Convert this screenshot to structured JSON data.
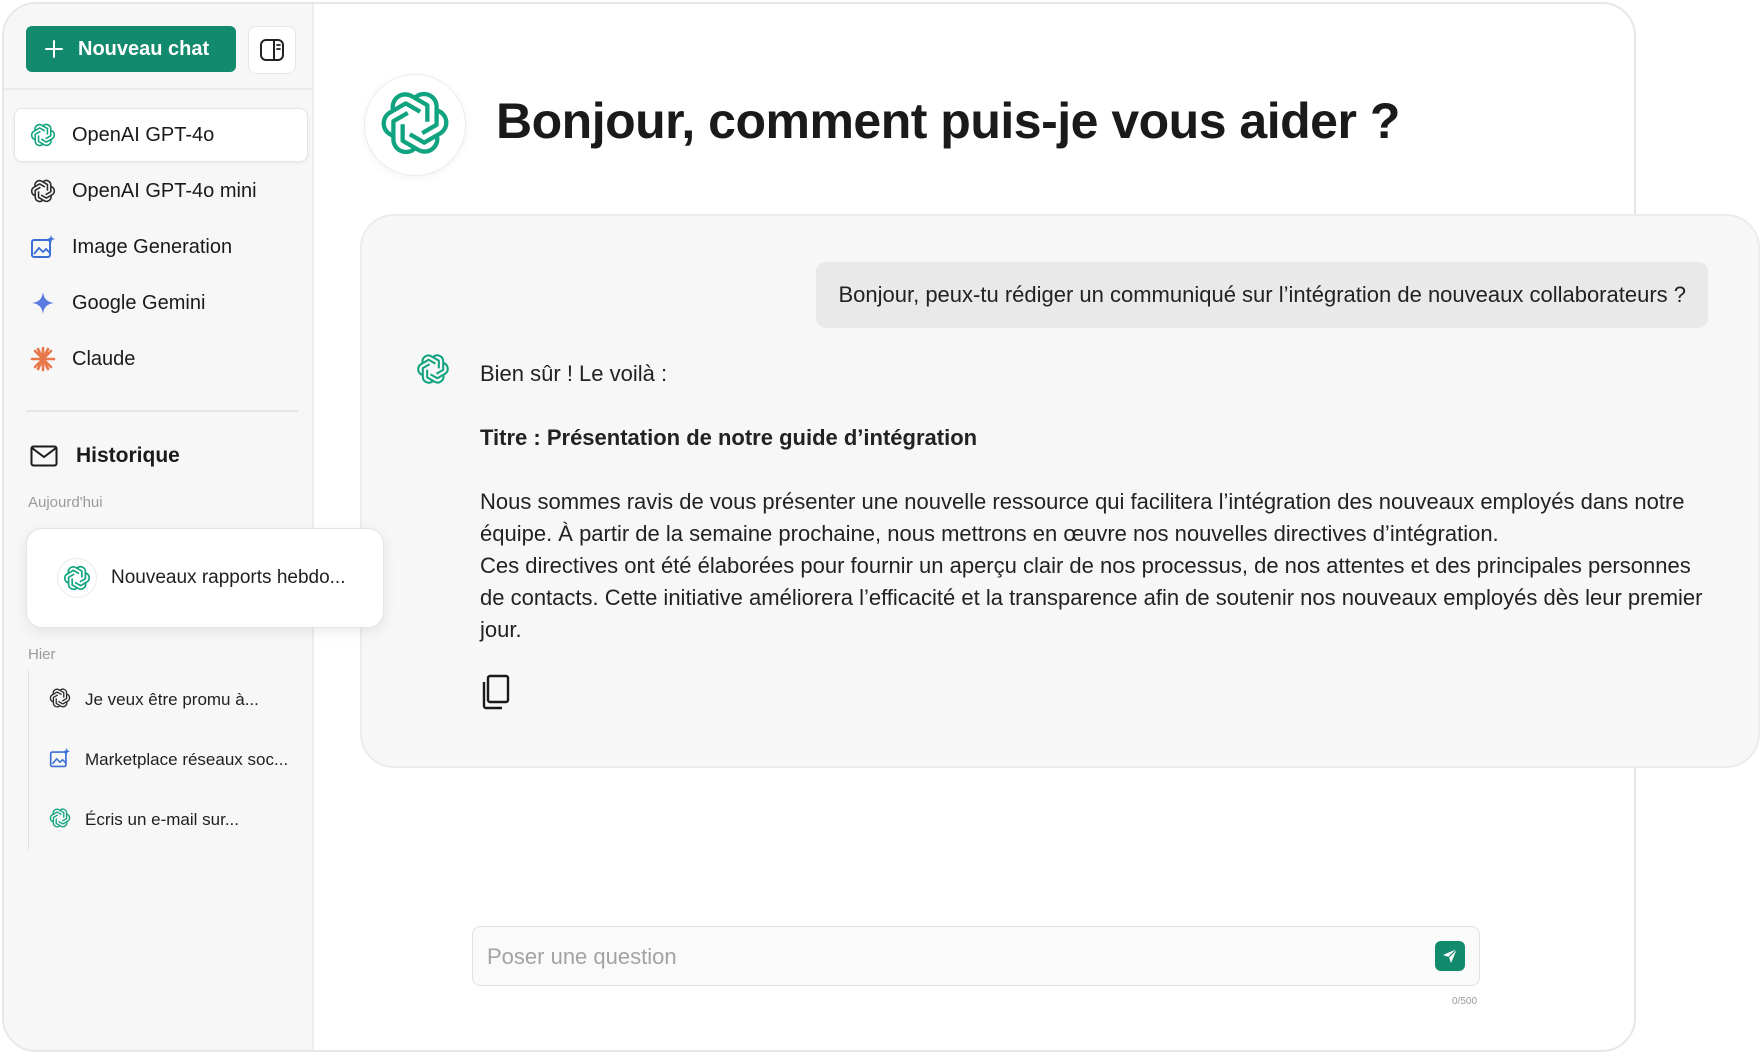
{
  "sidebar": {
    "new_chat_label": "Nouveau chat",
    "models": [
      {
        "label": "OpenAI GPT-4o",
        "icon": "openai-icon",
        "active": true
      },
      {
        "label": "OpenAI GPT-4o mini",
        "icon": "openai-icon",
        "active": false
      },
      {
        "label": "Image Generation",
        "icon": "image-generation-icon",
        "active": false
      },
      {
        "label": "Google Gemini",
        "icon": "gemini-icon",
        "active": false
      },
      {
        "label": "Claude",
        "icon": "claude-icon",
        "active": false
      }
    ],
    "history_title": "Historique",
    "history_icon": "envelope-icon",
    "today_label": "Aujourd'hui",
    "today_items": [
      {
        "label": "Nouveaux rapports hebdo...",
        "icon": "openai-icon"
      }
    ],
    "yesterday_label": "Hier",
    "yesterday_items": [
      {
        "label": "Je veux être promu à...",
        "icon": "openai-icon"
      },
      {
        "label": "Marketplace réseaux soc...",
        "icon": "image-generation-icon"
      },
      {
        "label": "Écris un e-mail sur...",
        "icon": "openai-icon"
      }
    ]
  },
  "main": {
    "welcome_title": "Bonjour, comment puis-je vous aider ?",
    "user_message": "Bonjour, peux-tu rédiger un communiqué sur l’intégration de nouveaux collaborateurs ?",
    "assistant": {
      "intro": "Bien sûr ! Le voilà :",
      "heading": "Titre : Présentation de notre guide d’intégration",
      "paragraph_1": "Nous sommes ravis de vous présenter une nouvelle ressource qui facilitera l’intégration des nouveaux employés dans notre équipe. À partir de la semaine prochaine, nous mettrons en œuvre nos nouvelles directives d’intégration.",
      "paragraph_2": "Ces directives ont été élaborées pour fournir un aperçu clair de nos processus, de nos attentes et des principales personnes de contacts. Cette initiative améliorera l’efficacité et la transparence afin de soutenir nos nouveaux employés dès leur premier jour."
    },
    "input": {
      "placeholder": "Poser une question",
      "value": "",
      "counter": "0/500"
    }
  },
  "colors": {
    "accent": "#128a6d",
    "openai": "#10a37f",
    "image_generation": "#3b6fd6",
    "gemini": "#5b7be0",
    "claude": "#e8774a",
    "sidebar_bg": "#f7f7f7",
    "panel_bg": "#f7f7f7"
  }
}
